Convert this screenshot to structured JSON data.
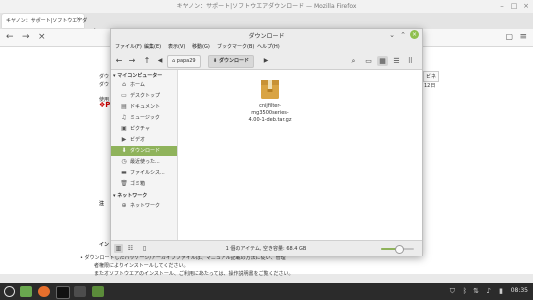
{
  "browser": {
    "window_title": "キヤノン：サポート|ソフトウエアダウンロード — Mozilla Firefox",
    "tab_label": "キヤノン：サポート|ソフトウエアダ",
    "new_tab_icon": "plus-icon",
    "page_text": {
      "heading_fragment": "Pi",
      "left_line1": "ダウ",
      "left_line2": "ダウ",
      "use_label": "使用",
      "right_fragment1": "ビネ",
      "right_fragment2": "12日",
      "note_label": "注",
      "install_label": "イン",
      "footer_line1": "• ダウンロードしたパッケージ/アーカイブファイルは、マニュアル記載の方法に従い、管理",
      "footer_line2": "者権限によりインストールしてください。",
      "footer_line3": "またオソフトウエアのインストール、ご利用にあたっては、操作説明書をご覧ください。"
    }
  },
  "file_manager": {
    "title": "ダウンロード",
    "menu": [
      "ファイル(F)",
      "編集(E)",
      "表示(V)",
      "移動(G)",
      "ブックマーク(B)",
      "ヘルプ(H)"
    ],
    "breadcrumb": {
      "home": "papa29",
      "current": "ダウンロード"
    },
    "sidebar": {
      "computer_header": "マイコンピューター",
      "network_header": "ネットワーク",
      "items": [
        {
          "label": "ホーム",
          "icon": "home-icon"
        },
        {
          "label": "デスクトップ",
          "icon": "desktop-icon"
        },
        {
          "label": "ドキュメント",
          "icon": "document-icon"
        },
        {
          "label": "ミュージック",
          "icon": "music-icon"
        },
        {
          "label": "ピクチャ",
          "icon": "picture-icon"
        },
        {
          "label": "ビデオ",
          "icon": "video-icon"
        },
        {
          "label": "ダウンロード",
          "icon": "download-icon",
          "selected": true
        },
        {
          "label": "最近使った...",
          "icon": "recent-icon"
        },
        {
          "label": "ファイルシス...",
          "icon": "drive-icon"
        },
        {
          "label": "ゴミ箱",
          "icon": "trash-icon"
        }
      ],
      "network_items": [
        {
          "label": "ネットワーク",
          "icon": "network-icon"
        }
      ]
    },
    "files": [
      {
        "name": "cnijfilter-mg3500series-4.00-1-deb.tar.gz",
        "name_display": "cnijfilter-\nmg3500series-\n4.00-1-deb.tar.gz",
        "icon": "archive-icon"
      }
    ],
    "status_text": "1 個のアイテム, 空き容量: 68.4 GB",
    "zoom_level": 0.55,
    "accent_color": "#8fb35b"
  },
  "taskbar": {
    "clock": "08:35",
    "apps": [
      "menu-icon",
      "file-manager-icon",
      "firefox-icon",
      "terminal-icon",
      "folder-icon"
    ]
  }
}
